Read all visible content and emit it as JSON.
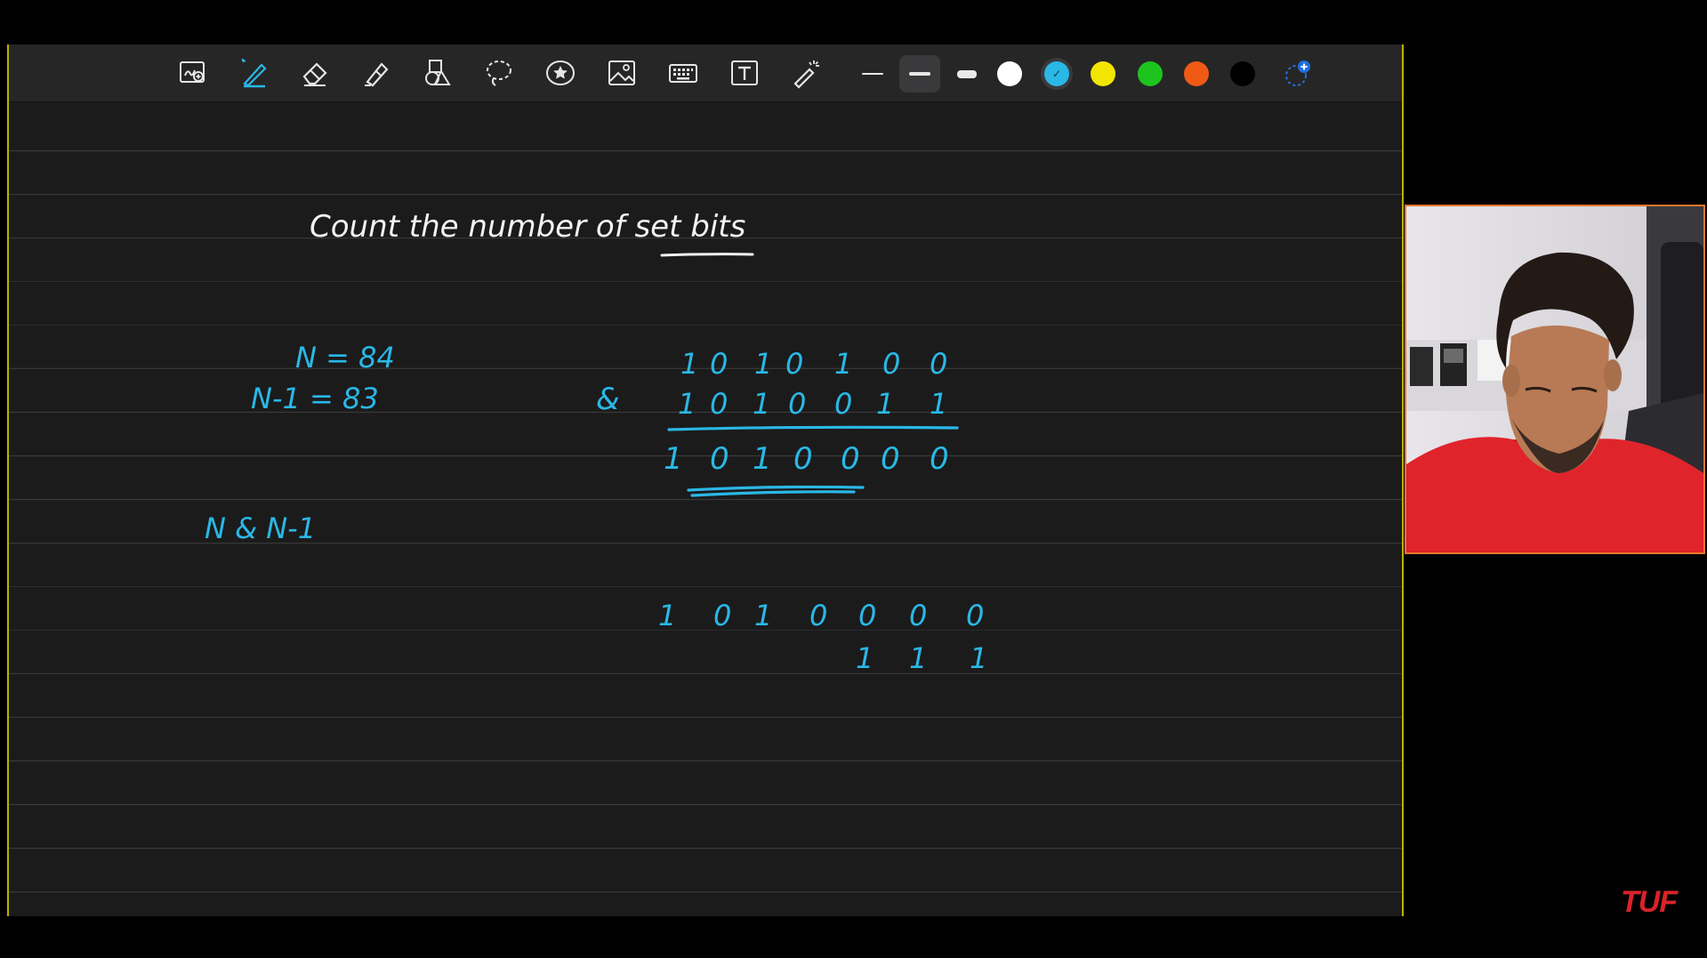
{
  "colors": {
    "canvas": "#1b1b1c",
    "toolbar": "#262627",
    "frame_border": "#b8b000",
    "ink_white": "#f2f2f2",
    "ink_cyan": "#2ab8e6",
    "webcam_border": "#e9762b",
    "brand_red": "#d8232a"
  },
  "toolbar": {
    "tools": [
      {
        "name": "zoom-lasso-tool",
        "icon": "zoom-box-icon"
      },
      {
        "name": "pen-tool",
        "icon": "pen-icon",
        "active": true
      },
      {
        "name": "eraser-tool",
        "icon": "eraser-icon"
      },
      {
        "name": "highlighter-tool",
        "icon": "highlighter-icon"
      },
      {
        "name": "shapes-tool",
        "icon": "shapes-icon"
      },
      {
        "name": "lasso-tool",
        "icon": "lasso-icon"
      },
      {
        "name": "sticker-tool",
        "icon": "star-sticker-icon"
      },
      {
        "name": "image-tool",
        "icon": "image-icon"
      },
      {
        "name": "keyboard-tool",
        "icon": "keyboard-icon"
      },
      {
        "name": "textbox-tool",
        "icon": "text-box-icon"
      },
      {
        "name": "laser-pointer-tool",
        "icon": "laser-pointer-icon"
      }
    ],
    "stroke_widths": [
      {
        "name": "thin",
        "selected": false
      },
      {
        "name": "medium",
        "selected": true
      },
      {
        "name": "thick",
        "selected": false
      }
    ],
    "swatches": [
      {
        "name": "white",
        "hex": "#ffffff",
        "selected": false
      },
      {
        "name": "cyan",
        "hex": "#2ab8e6",
        "selected": true
      },
      {
        "name": "yellow",
        "hex": "#f2e600",
        "selected": false
      },
      {
        "name": "green",
        "hex": "#1ec41e",
        "selected": false
      },
      {
        "name": "orange",
        "hex": "#f05a14",
        "selected": false
      },
      {
        "name": "black",
        "hex": "#000000",
        "selected": false
      }
    ]
  },
  "notes": {
    "title": "Count the number of set bits",
    "n_line": "N = 84",
    "n_minus_1_line": "N-1 = 83",
    "expression": "N & N-1",
    "and_sign": "&",
    "row1": [
      "1",
      "0",
      "1",
      "0",
      "1",
      "0",
      "0"
    ],
    "row2": [
      "1",
      "0",
      "1",
      "0",
      "0",
      "1",
      "1"
    ],
    "row3": [
      "1",
      "0",
      "1",
      "0",
      "0",
      "0",
      "0"
    ],
    "row4": [
      "1",
      "0",
      "1",
      "0",
      "0",
      "0",
      "0"
    ],
    "row5": [
      "1",
      "1",
      "1"
    ]
  },
  "brand": {
    "logo_text": "TUF"
  }
}
